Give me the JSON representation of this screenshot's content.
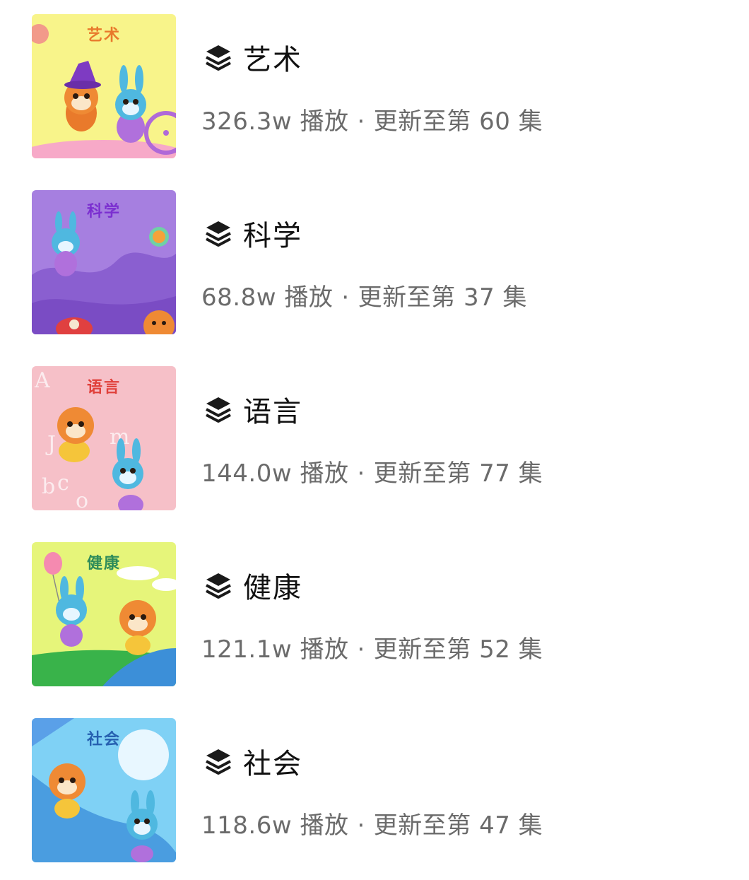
{
  "items": [
    {
      "title": "艺术",
      "thumb_label": "艺术",
      "plays": "326.3w 播放",
      "update": "更新至第 60 集",
      "colors": {
        "bg": "#f8f48a",
        "label": "#e8792b"
      }
    },
    {
      "title": "科学",
      "thumb_label": "科学",
      "plays": "68.8w 播放",
      "update": "更新至第 37 集",
      "colors": {
        "bg": "#a67fe0",
        "label": "#7b2fd0"
      }
    },
    {
      "title": "语言",
      "thumb_label": "语言",
      "plays": "144.0w 播放",
      "update": "更新至第 77 集",
      "colors": {
        "bg": "#f6c0c8",
        "label": "#e0403b"
      }
    },
    {
      "title": "健康",
      "thumb_label": "健康",
      "plays": "121.1w 播放",
      "update": "更新至第 52 集",
      "colors": {
        "bg": "#e6f57a",
        "label": "#2f8c5a"
      }
    },
    {
      "title": "社会",
      "thumb_label": "社会",
      "plays": "118.6w 播放",
      "update": "更新至第 47 集",
      "colors": {
        "bg": "#7fd1f5",
        "label": "#2660b0"
      }
    }
  ],
  "separator": "·",
  "icon": "layers-icon"
}
